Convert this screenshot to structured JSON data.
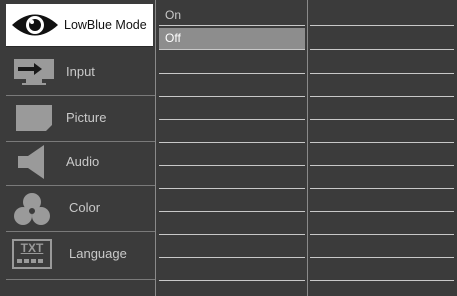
{
  "menu": {
    "items": [
      {
        "label": "LowBlue Mode",
        "icon": "eye-icon",
        "selected": true
      },
      {
        "label": "Input",
        "icon": "input-icon",
        "selected": false
      },
      {
        "label": "Picture",
        "icon": "picture-icon",
        "selected": false
      },
      {
        "label": "Audio",
        "icon": "speaker-icon",
        "selected": false
      },
      {
        "label": "Color",
        "icon": "color-icon",
        "selected": false
      },
      {
        "label": "Language",
        "icon": "language-icon",
        "selected": false
      }
    ],
    "language_icon_text": "TXT"
  },
  "submenu": {
    "options": [
      {
        "label": "On",
        "highlighted": false
      },
      {
        "label": "Off",
        "highlighted": true
      }
    ]
  },
  "colors": {
    "background": "#3b3b3b",
    "selected_bg": "#ffffff",
    "highlight_bg": "#8d8d8d",
    "text": "#c9c9c9"
  }
}
